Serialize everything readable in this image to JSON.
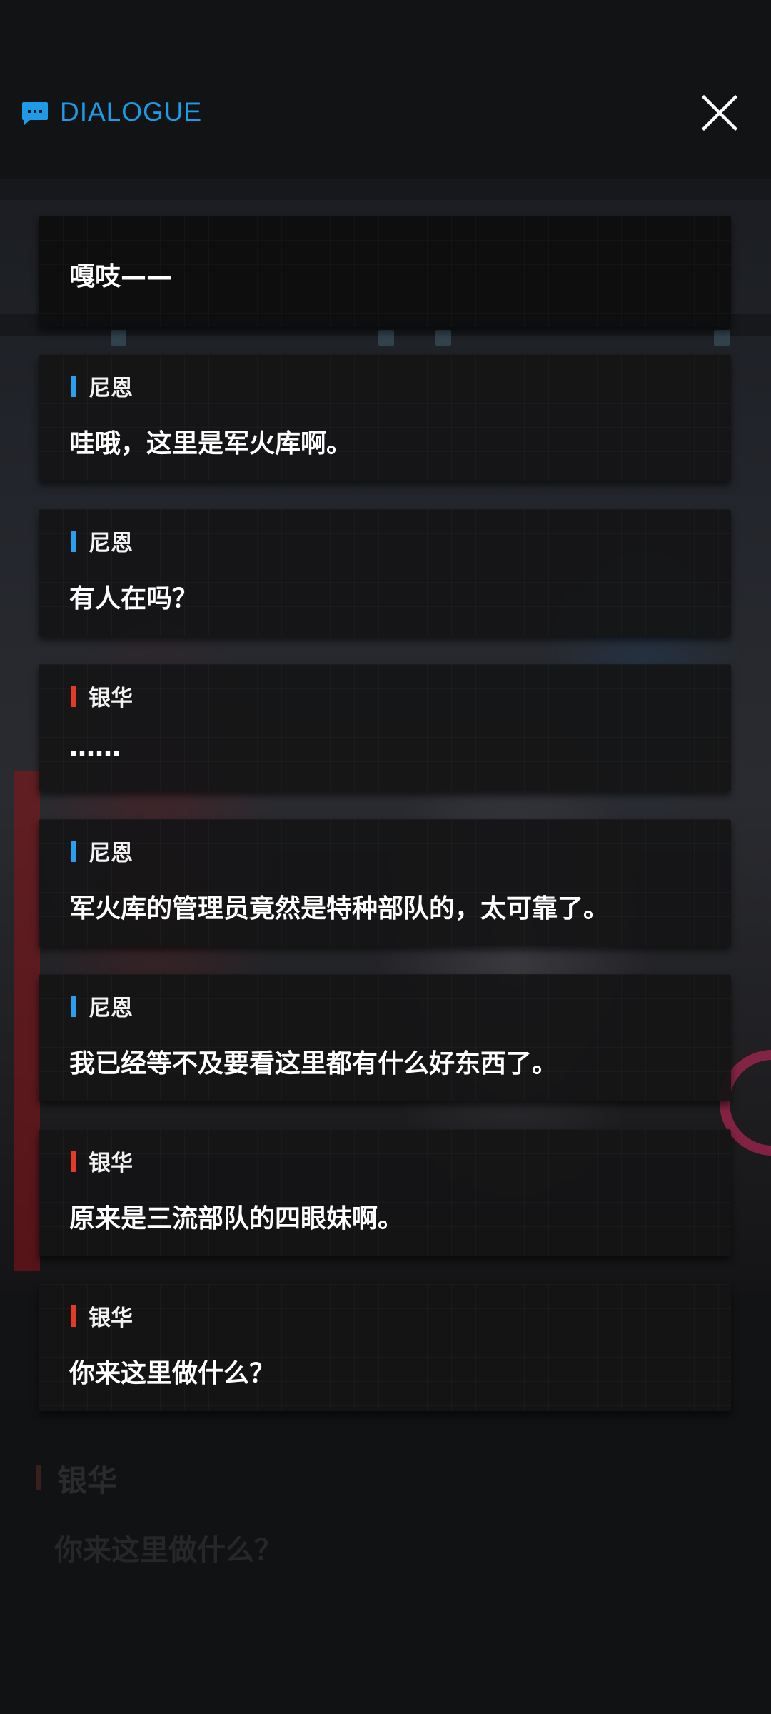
{
  "header": {
    "title": "DIALOGUE",
    "icon": "chat-bubble-icon",
    "close_icon": "close-icon"
  },
  "colors": {
    "accent": "#1e9be6",
    "speaker_blue": "#2a9ff0",
    "speaker_red": "#e63a28"
  },
  "log": [
    {
      "speaker": "",
      "text": "嘎吱——"
    },
    {
      "speaker": "尼恩",
      "marker": "blue",
      "text": "哇哦，这里是军火库啊。"
    },
    {
      "speaker": "尼恩",
      "marker": "blue",
      "text": "有人在吗？"
    },
    {
      "speaker": "银华",
      "marker": "red",
      "text": "……"
    },
    {
      "speaker": "尼恩",
      "marker": "blue",
      "text": "军火库的管理员竟然是特种部队的，太可靠了。"
    },
    {
      "speaker": "尼恩",
      "marker": "blue",
      "text": "我已经等不及要看这里都有什么好东西了。"
    },
    {
      "speaker": "银华",
      "marker": "red",
      "text": "原来是三流部队的四眼妹啊。"
    },
    {
      "speaker": "银华",
      "marker": "red",
      "text": "你来这里做什么？"
    }
  ],
  "background_dialogue": {
    "speaker": "银华",
    "text": "你来这里做什么？"
  }
}
